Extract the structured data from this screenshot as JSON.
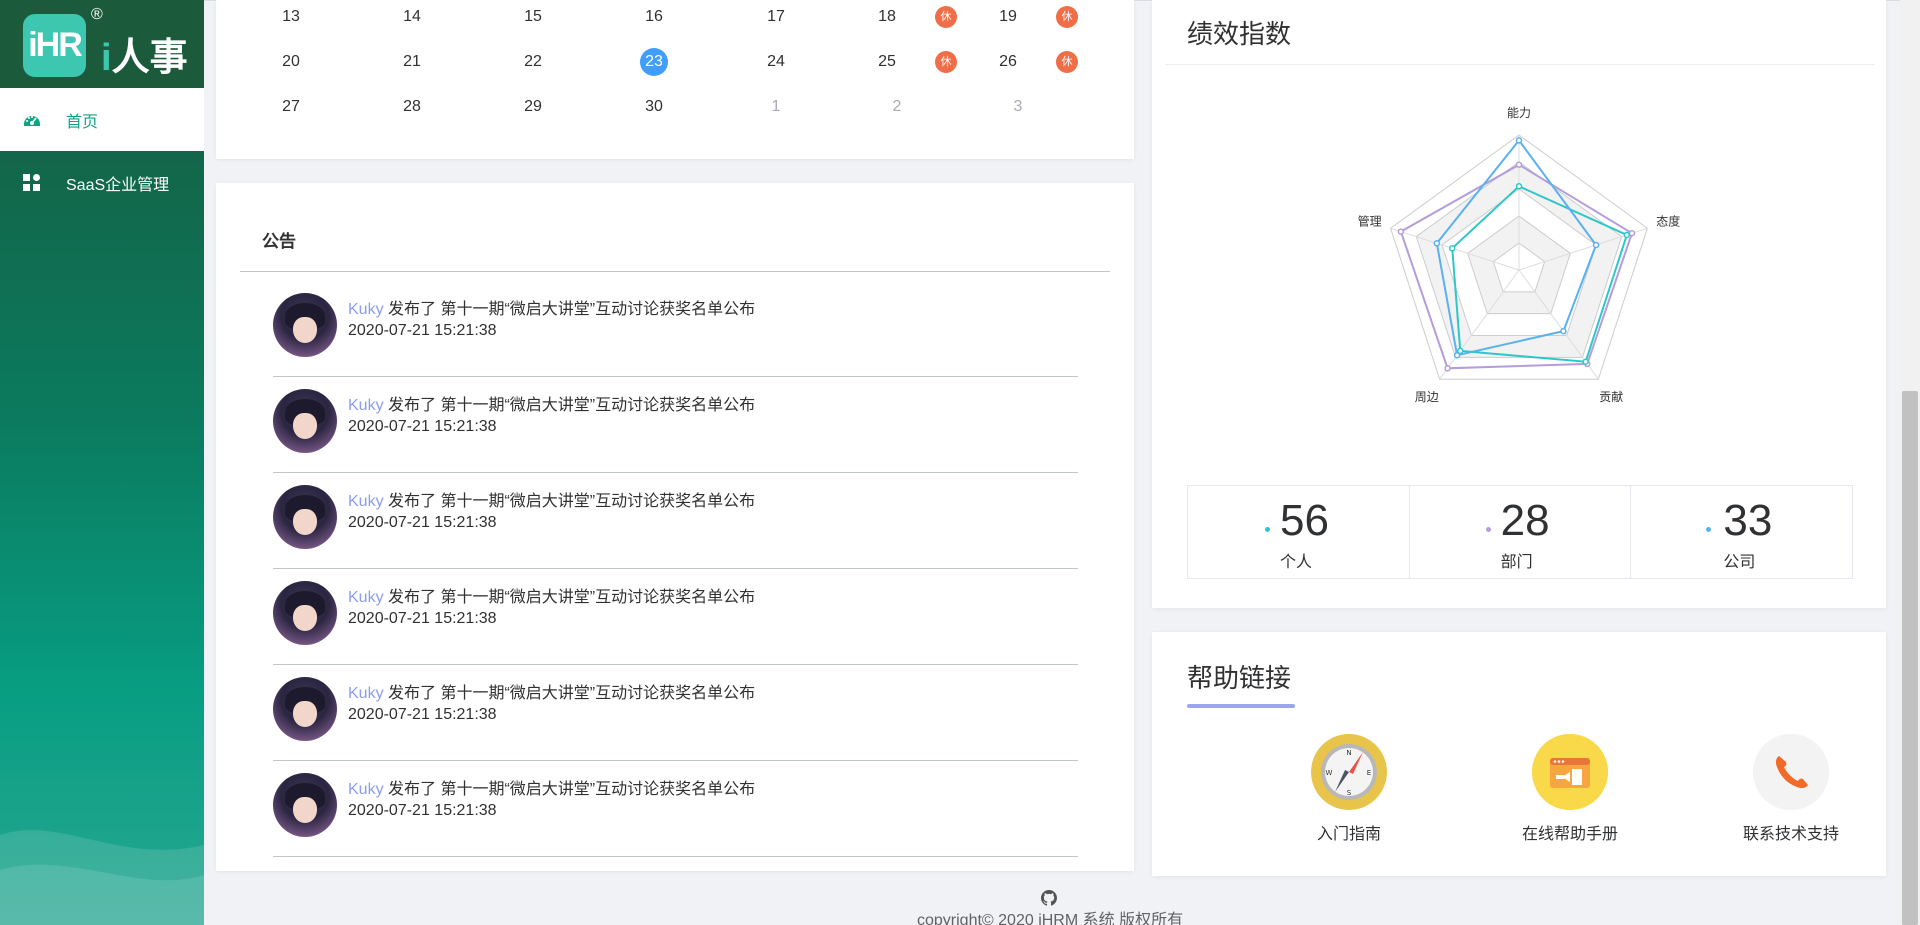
{
  "app": {
    "logo_mark": "iHR",
    "logo_reg": "®",
    "logo_text_i": "i",
    "logo_text_rest": "人事"
  },
  "sidebar": {
    "items": [
      {
        "label": "首页",
        "icon": "dashboard-icon",
        "active": true
      },
      {
        "label": "SaaS企业管理",
        "icon": "grid-icon",
        "active": false
      }
    ]
  },
  "calendar": {
    "rest_label": "休",
    "rows": [
      [
        {
          "d": "13"
        },
        {
          "d": "14"
        },
        {
          "d": "15"
        },
        {
          "d": "16"
        },
        {
          "d": "17"
        },
        {
          "d": "18",
          "rest": true
        },
        {
          "d": "19",
          "rest": true
        }
      ],
      [
        {
          "d": "20"
        },
        {
          "d": "21"
        },
        {
          "d": "22"
        },
        {
          "d": "23",
          "today": true
        },
        {
          "d": "24"
        },
        {
          "d": "25",
          "rest": true
        },
        {
          "d": "26",
          "rest": true
        }
      ],
      [
        {
          "d": "27"
        },
        {
          "d": "28"
        },
        {
          "d": "29"
        },
        {
          "d": "30"
        },
        {
          "d": "1",
          "other": true
        },
        {
          "d": "2",
          "other": true
        },
        {
          "d": "3",
          "other": true
        }
      ]
    ]
  },
  "notice": {
    "title": "公告",
    "items": [
      {
        "user": "Kuky",
        "text": " 发布了 第十一期“微启大讲堂”互动讨论获奖名单公布",
        "time": "2020-07-21 15:21:38"
      },
      {
        "user": "Kuky",
        "text": " 发布了 第十一期“微启大讲堂”互动讨论获奖名单公布",
        "time": "2020-07-21 15:21:38"
      },
      {
        "user": "Kuky",
        "text": " 发布了 第十一期“微启大讲堂”互动讨论获奖名单公布",
        "time": "2020-07-21 15:21:38"
      },
      {
        "user": "Kuky",
        "text": " 发布了 第十一期“微启大讲堂”互动讨论获奖名单公布",
        "time": "2020-07-21 15:21:38"
      },
      {
        "user": "Kuky",
        "text": " 发布了 第十一期“微启大讲堂”互动讨论获奖名单公布",
        "time": "2020-07-21 15:21:38"
      },
      {
        "user": "Kuky",
        "text": " 发布了 第十一期“微启大讲堂”互动讨论获奖名单公布",
        "time": "2020-07-21 15:21:38"
      }
    ]
  },
  "performance": {
    "title": "绩效指数",
    "chart_data": {
      "type": "radar",
      "indicators": [
        "能力",
        "态度",
        "贡献",
        "周边",
        "管理"
      ],
      "max": 100,
      "series": [
        {
          "color": "#b39ddb",
          "values": [
            78,
            88,
            86,
            90,
            92
          ]
        },
        {
          "color": "#2ec7c9",
          "values": [
            62,
            84,
            84,
            74,
            52
          ]
        },
        {
          "color": "#5ab1ef",
          "values": [
            96,
            60,
            56,
            78,
            64
          ]
        }
      ]
    },
    "stats": [
      {
        "value": "56",
        "label": "个人",
        "color": "#2ec7c9"
      },
      {
        "value": "28",
        "label": "部门",
        "color": "#b39ddb"
      },
      {
        "value": "33",
        "label": "公司",
        "color": "#5ab1ef"
      }
    ]
  },
  "help": {
    "title": "帮助链接",
    "items": [
      {
        "label": "入门指南",
        "icon": "compass-icon"
      },
      {
        "label": "在线帮助手册",
        "icon": "manual-icon"
      },
      {
        "label": "联系技术支持",
        "icon": "phone-icon"
      }
    ]
  },
  "footer": {
    "text": "copyright© 2020 iHRM 系统 版权所有",
    "icon": "github-icon"
  }
}
